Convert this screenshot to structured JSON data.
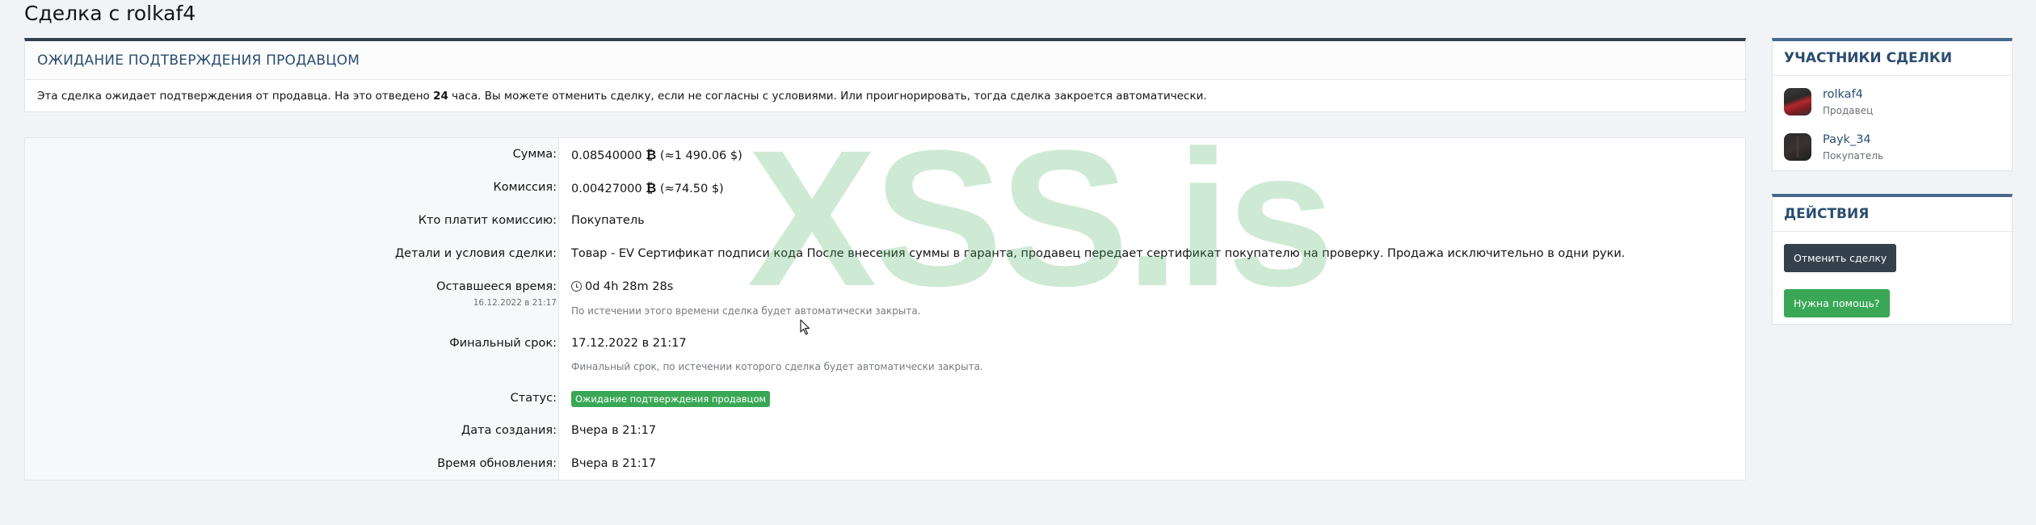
{
  "page": {
    "title": "Сделка с rolkaf4"
  },
  "notice": {
    "title": "ОЖИДАНИЕ ПОДТВЕРЖДЕНИЯ ПРОДАВЦОМ",
    "text_before": "Эта сделка ожидает подтверждения от продавца. На это отведено ",
    "hours": "24",
    "text_after": " часа. Вы можете отменить сделку, если не согласны с условиями. Или проигнорировать, тогда сделка закроется автоматически."
  },
  "details": {
    "amount": {
      "label": "Сумма:",
      "value": "0.08540000",
      "currency_symbol": "₿",
      "approx": "(≈1 490.06 $)"
    },
    "fee": {
      "label": "Комиссия:",
      "value": "0.00427000",
      "currency_symbol": "₿",
      "approx": "(≈74.50 $)"
    },
    "fee_payer": {
      "label": "Кто платит комиссию:",
      "value": "Покупатель"
    },
    "terms": {
      "label": "Детали и условия сделки:",
      "value": "Товар - EV Сертификат подписи кода После внесения суммы в гаранта, продавец передает сертификат покупателю на проверку. Продажа исключительно в одни руки."
    },
    "time_left": {
      "label": "Оставшееся время:",
      "sub": "16.12.2022 в 21:17",
      "value": "0d 4h 28m 28s",
      "hint": "По истечении этого времени сделка будет автоматически закрыта."
    },
    "deadline": {
      "label": "Финальный срок:",
      "value": "17.12.2022 в 21:17",
      "hint": "Финальный срок, по истечении которого сделка будет автоматически закрыта."
    },
    "status": {
      "label": "Статус:",
      "value": "Ожидание подтверждения продавцом"
    },
    "created": {
      "label": "Дата создания:",
      "value": "Вчера в 21:17"
    },
    "updated": {
      "label": "Время обновления:",
      "value": "Вчера в 21:17"
    }
  },
  "watermark": {
    "text": "XSS.is"
  },
  "sidebar": {
    "members": {
      "title": "УЧАСТНИКИ СДЕЛКИ",
      "items": [
        {
          "name": "rolkaf4",
          "role": "Продавец"
        },
        {
          "name": "Payk_34",
          "role": "Покупатель"
        }
      ]
    },
    "actions": {
      "title": "ДЕЙСТВИЯ",
      "cancel_label": "Отменить сделку",
      "help_label": "Нужна помощь?"
    }
  },
  "colors": {
    "accent": "#2b4d70",
    "dark_button": "#34404c",
    "success": "#3aa756"
  }
}
